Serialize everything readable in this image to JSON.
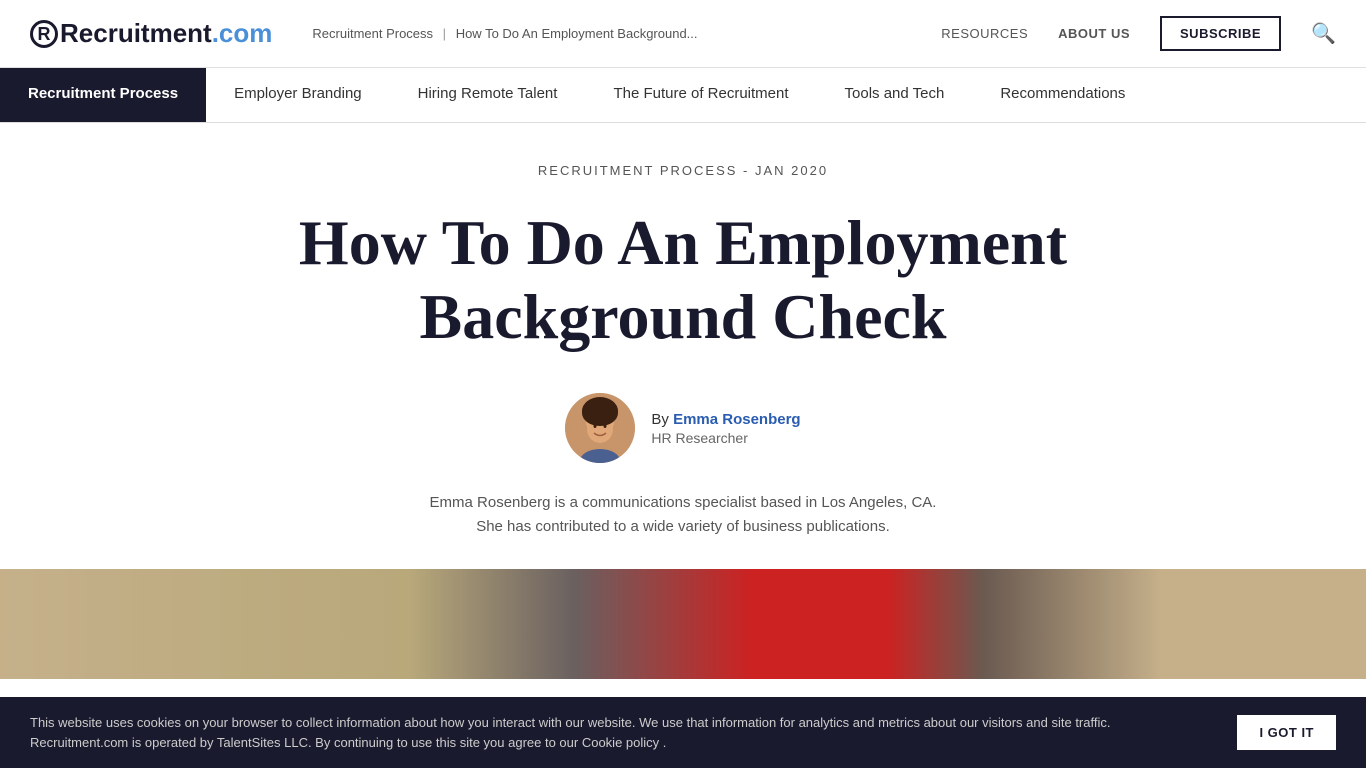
{
  "site": {
    "logo_text_main": "Recruitment",
    "logo_text_com": ".com",
    "logo_r": "R"
  },
  "header": {
    "breadcrumb_link": "Recruitment Process",
    "breadcrumb_sep": "|",
    "breadcrumb_current": "How To Do An Employment Background...",
    "resources": "RESOURCES",
    "about_us": "ABOUT US",
    "subscribe_label": "SUBSCRIBE"
  },
  "nav": {
    "items": [
      {
        "id": "recruitment-process",
        "label": "Recruitment Process",
        "active": true
      },
      {
        "id": "employer-branding",
        "label": "Employer Branding",
        "active": false
      },
      {
        "id": "hiring-remote-talent",
        "label": "Hiring Remote Talent",
        "active": false
      },
      {
        "id": "future-of-recruitment",
        "label": "The Future of Recruitment",
        "active": false
      },
      {
        "id": "tools-and-tech",
        "label": "Tools and Tech",
        "active": false
      },
      {
        "id": "recommendations",
        "label": "Recommendations",
        "active": false
      }
    ]
  },
  "article": {
    "category": "RECRUITMENT PROCESS - JAN 2020",
    "title_line1": "How To Do An Employment",
    "title_line2": "Background Check",
    "author_by": "By",
    "author_name": "Emma Rosenberg",
    "author_role": "HR Researcher",
    "author_bio_line1": "Emma Rosenberg is a communications specialist based in Los Angeles, CA.",
    "author_bio_line2": "She has contributed to a wide variety of business publications."
  },
  "cookie": {
    "text": "This website uses cookies on your browser to collect information about how you interact with our website. We use that information for analytics and metrics about our visitors and site traffic. Recruitment.com is operated by TalentSites LLC. By continuing to use this site you agree to our Cookie policy .",
    "button_label": "I GOT IT"
  }
}
